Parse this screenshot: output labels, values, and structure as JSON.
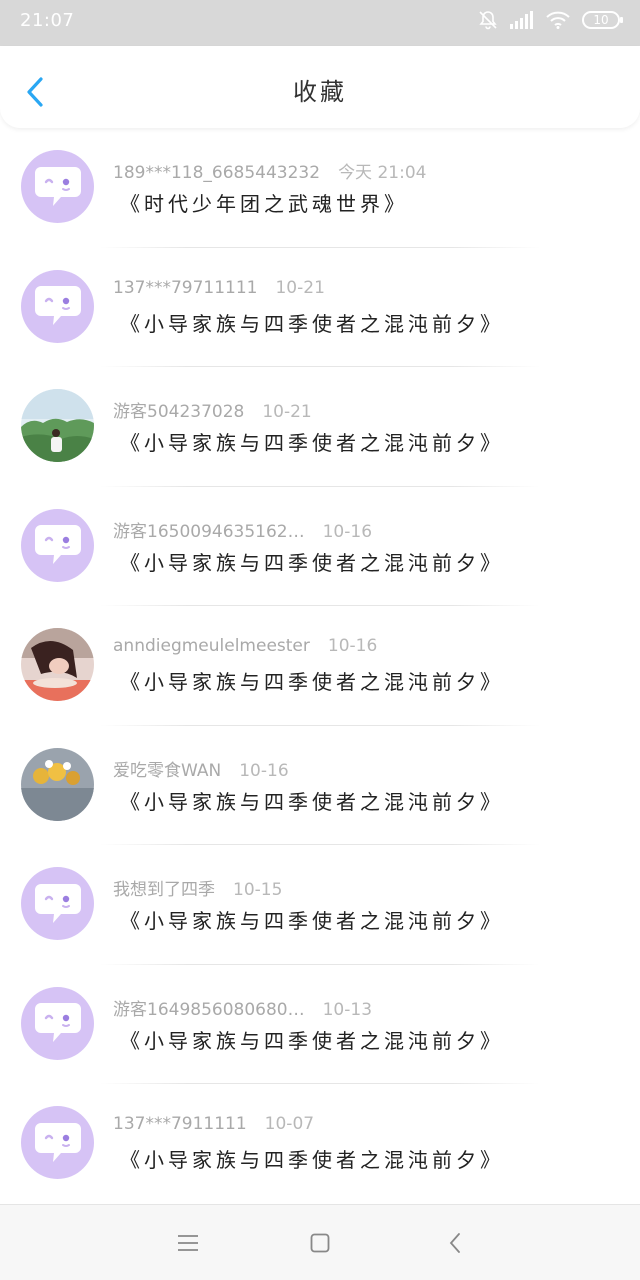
{
  "status_bar": {
    "time": "21:07",
    "battery": "10"
  },
  "header": {
    "title": "收藏"
  },
  "colors": {
    "accent": "#2aa7f3",
    "avatar_bg": "#d6c3f5"
  },
  "items": [
    {
      "user": "189***118_6685443232",
      "time": "今天 21:04",
      "title": "《时代少年团之武魂世界》",
      "avatar": "default-avatar-icon"
    },
    {
      "user": "137***79711111",
      "time": "10-21",
      "title": "《小导家族与四季使者之混沌前夕》",
      "avatar": "default-avatar-icon"
    },
    {
      "user": "游客504237028",
      "time": "10-21",
      "title": "《小导家族与四季使者之混沌前夕》",
      "avatar": "photo-outdoor-person"
    },
    {
      "user": "游客1650094635162…",
      "time": "10-16",
      "title": "《小导家族与四季使者之混沌前夕》",
      "avatar": "default-avatar-icon"
    },
    {
      "user": "anndiegmeulelmeester",
      "time": "10-16",
      "title": "《小导家族与四季使者之混沌前夕》",
      "avatar": "photo-girl-at-table"
    },
    {
      "user": "爱吃零食WAN",
      "time": "10-16",
      "title": "《小导家族与四季使者之混沌前夕》",
      "avatar": "photo-toys"
    },
    {
      "user": "我想到了四季",
      "time": "10-15",
      "title": "《小导家族与四季使者之混沌前夕》",
      "avatar": "default-avatar-icon"
    },
    {
      "user": "游客1649856080680…",
      "time": "10-13",
      "title": "《小导家族与四季使者之混沌前夕》",
      "avatar": "default-avatar-icon"
    },
    {
      "user": "137***7911111",
      "time": "10-07",
      "title": "《小导家族与四季使者之混沌前夕》",
      "avatar": "default-avatar-icon"
    }
  ]
}
